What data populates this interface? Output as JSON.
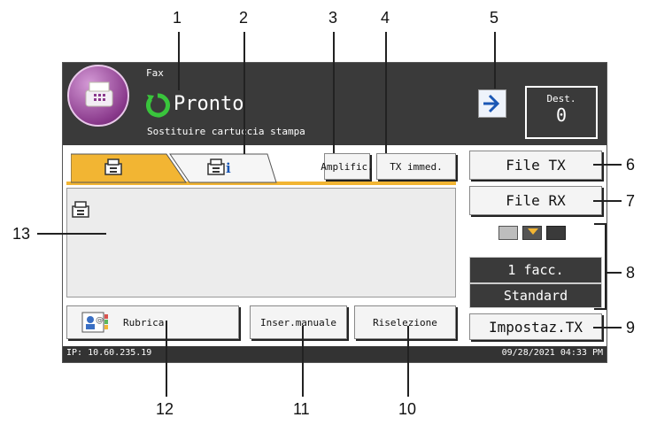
{
  "header": {
    "mode_label": "Fax",
    "status": "Pronto",
    "message": "Sostituire cartuccia stampa",
    "dest_label": "Dest.",
    "dest_count": "0"
  },
  "toolbar": {
    "amplific_label": "Amplific.",
    "tx_immed_label": "TX immed."
  },
  "side": {
    "file_tx_label": "File TX",
    "file_rx_label": "File RX",
    "pages_label": "1 facc.",
    "quality_label": "Standard",
    "settings_label": "Impostaz.TX"
  },
  "bottom_buttons": {
    "rubrica_label": "Rubrica",
    "manual_label": "Inser.manuale",
    "redial_label": "Riselezione"
  },
  "status_bar": {
    "ip": "IP: 10.60.235.19",
    "datetime": "09/28/2021 04:33 PM"
  },
  "callouts": [
    "1",
    "2",
    "3",
    "4",
    "5",
    "6",
    "7",
    "8",
    "9",
    "10",
    "11",
    "12",
    "13"
  ],
  "colors": {
    "tab_active": "#f2b533",
    "header_bg": "#3a3a3a",
    "status_icon": "#39c43c"
  }
}
